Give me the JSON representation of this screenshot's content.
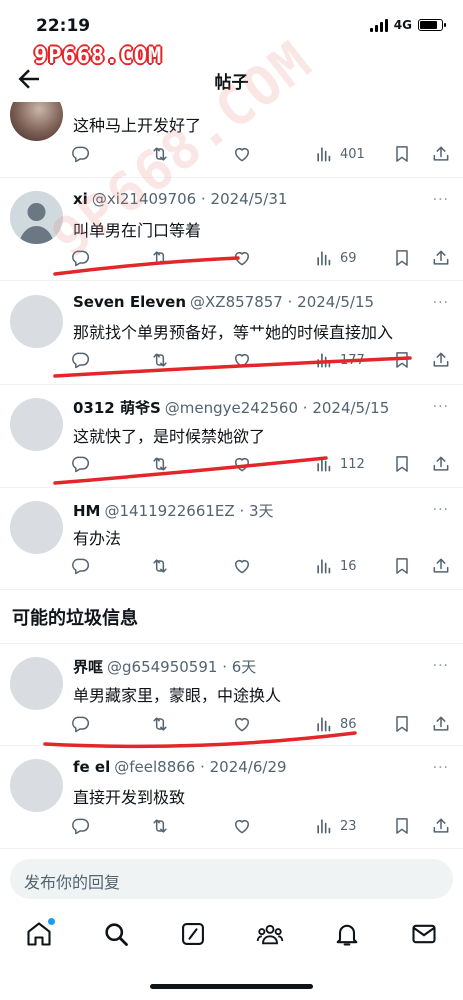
{
  "status": {
    "time": "22:19",
    "network": "4G"
  },
  "watermark": {
    "top": "9P668.COM",
    "diagonal": "9P668.COM"
  },
  "header": {
    "title": "帖子"
  },
  "replies": [
    {
      "name": "",
      "handle": "",
      "text": "这种马上开发好了",
      "views": "401"
    },
    {
      "name": "xi",
      "handle": "@xi21409706 · 2024/5/31",
      "text": "叫单男在门口等着",
      "views": "69"
    },
    {
      "name": "Seven Eleven",
      "handle": "@XZ857857 · 2024/5/15",
      "text": "那就找个单男预备好，等艹她的时候直接加入",
      "views": "177"
    },
    {
      "name": "0312 萌爷S",
      "handle": "@mengye242560 · 2024/5/15",
      "text": "这就快了，是时候禁她欲了",
      "views": "112"
    },
    {
      "name": "HM",
      "handle": "@1411922661EZ · 3天",
      "text": "有办法",
      "views": "16"
    },
    {
      "name": "界哐",
      "handle": "@g654950591 · 6天",
      "text": "单男藏家里，蒙眼，中途换人",
      "views": "86"
    },
    {
      "name": "fe el",
      "handle": "@feel8866 · 2024/6/29",
      "text": "直接开发到极致",
      "views": "23"
    }
  ],
  "section": {
    "spam_title": "可能的垃圾信息"
  },
  "compose": {
    "placeholder": "发布你的回复"
  },
  "icons": {
    "back": "back-arrow-icon",
    "reply": "reply-icon",
    "retweet": "retweet-icon",
    "like": "heart-icon",
    "views": "views-icon",
    "bookmark": "bookmark-icon",
    "share": "share-icon",
    "tabs": [
      "home-icon",
      "search-icon",
      "grok-icon",
      "communities-icon",
      "notifications-icon",
      "messages-icon"
    ]
  },
  "colors": {
    "accent": "#1d9bf0",
    "text": "#0f1419",
    "muted": "#536471",
    "marker": "#e3262a"
  }
}
